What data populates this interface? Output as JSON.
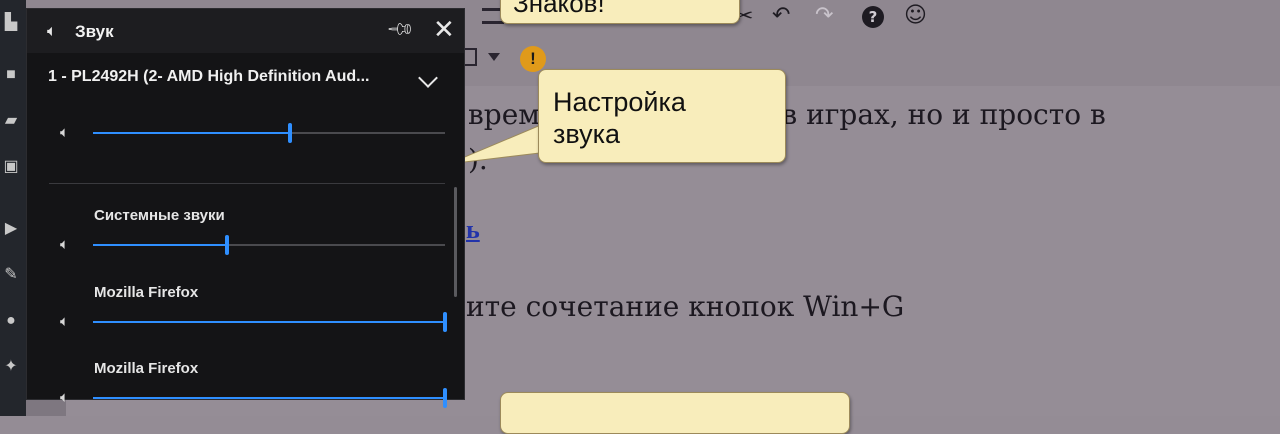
{
  "panel": {
    "title": "Звук",
    "device": "1 - PL2492H (2- AMD High Definition Aud...",
    "master_volume": 0.56,
    "apps": [
      {
        "label": "Системные звуки",
        "volume": 0.38
      },
      {
        "label": "Mozilla Firefox",
        "volume": 1.0
      },
      {
        "label": "Mozilla Firefox",
        "volume": 1.0
      }
    ]
  },
  "callouts": {
    "top": "Знаков!",
    "main": "Настройка\nзвука"
  },
  "article": {
    "line1": "время                              лна не только в играх, но и просто в",
    "line2": "                                ).",
    "link": "ь",
    "line3": "ите сочетание кнопок Win+G"
  },
  "colors": {
    "accent": "#2f8fff",
    "panel_bg": "#141416",
    "callout_bg": "#f8edbb"
  }
}
